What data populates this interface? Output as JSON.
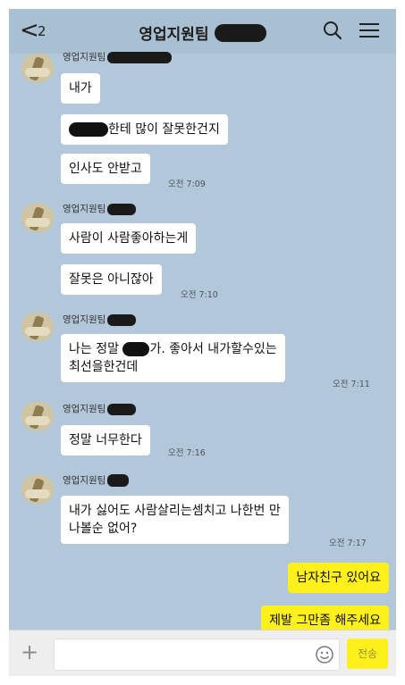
{
  "header": {
    "back_count": "2",
    "title": "영업지원팀",
    "icons": [
      "back-chevron-icon",
      "search-icon",
      "menu-icon"
    ]
  },
  "messages": {
    "top_name": "영업지원팀",
    "g1": {
      "m1": "내가",
      "m2_suffix": "한테 많이 잘못한건지",
      "m3": "인사도 안받고",
      "time": "오전 7:09"
    },
    "g2": {
      "name": "영업지원팀",
      "m1": "사람이 사람좋아하는게",
      "m2": "잘못은 아니잖아",
      "time": "오전 7:10"
    },
    "g3": {
      "name": "영업지원팀",
      "line1_prefix": "나는 정말",
      "line1_suffix": "가. 좋아서 내가할수있는",
      "line2": "최선을한건데",
      "time": "오전 7:11"
    },
    "g4": {
      "name": "영업지원팀",
      "m1": "정말 너무한다",
      "time": "오전 7:16"
    },
    "g5": {
      "name": "영업지원팀",
      "line1": "내가 싫어도 사람살리는셈치고 나한번 만",
      "line2": "나볼순 없어?",
      "time": "오전 7:17"
    },
    "me": {
      "m1": "남자친구 있어요",
      "m2": "제발 그만좀 해주세요"
    }
  },
  "input": {
    "send_label": "전송",
    "placeholder": ""
  },
  "colors": {
    "background": "#b2c7d9",
    "my_bubble": "#fef01b",
    "their_bubble": "#ffffff"
  }
}
